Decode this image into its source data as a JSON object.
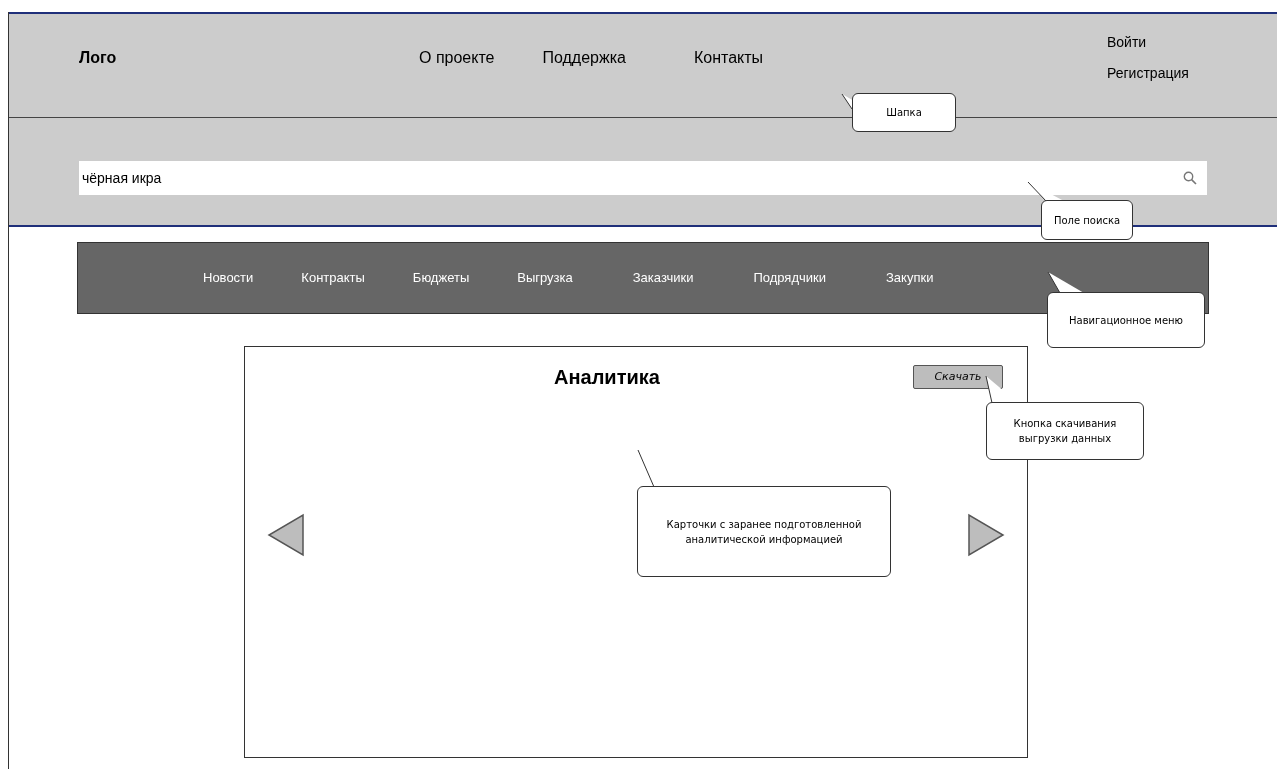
{
  "header": {
    "logo": "Лого",
    "links": [
      "О проекте",
      "Поддержка",
      "Контакты"
    ],
    "auth": [
      "Войти",
      "Регистрация"
    ]
  },
  "search": {
    "value": "чёрная икра"
  },
  "nav": [
    "Новости",
    "Контракты",
    "Бюджеты",
    "Выгрузка",
    "Заказчики",
    "Подрядчики",
    "Закупки"
  ],
  "card": {
    "title": "Аналитика",
    "download_button": "Скачать"
  },
  "annotations": [
    "Шапка",
    "Поле поиска",
    "Навигационное меню",
    "Кнопка скачивания выгрузки данных",
    "Карточки с заранее подготовленной аналитической информацией"
  ]
}
